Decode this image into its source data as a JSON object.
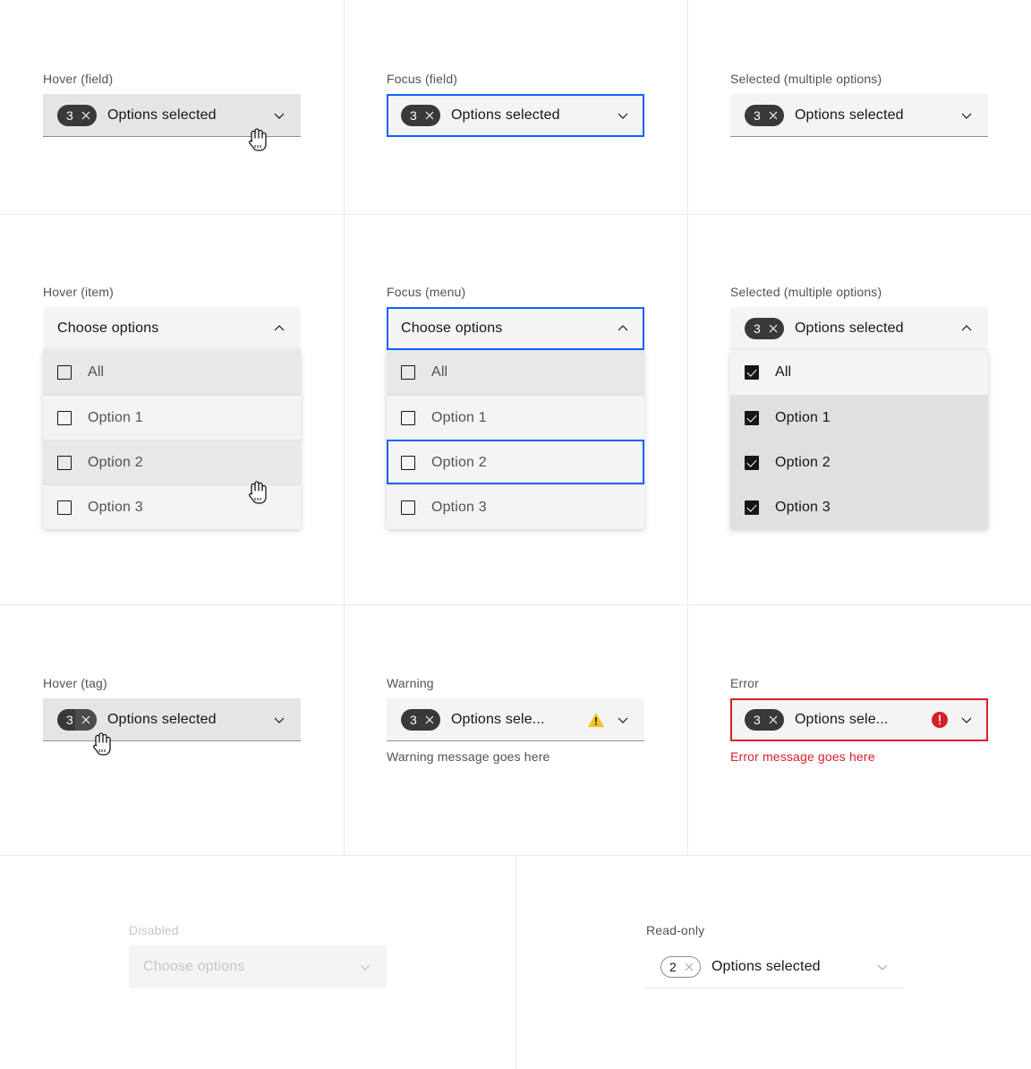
{
  "meta": {
    "component": "Multiselect dropdown states",
    "colors": {
      "field_bg": "#f4f4f4",
      "field_bg_hover": "#e5e5e5",
      "focus_blue": "#0f62fe",
      "error_red": "#da1e28",
      "warning_yellow": "#f1c21b",
      "tag_dark": "#393939",
      "text_primary": "#161616",
      "text_secondary": "#525252",
      "text_disabled": "#c6c6c6",
      "divider": "#e8e8e8",
      "menu_hover": "#e8e8e8",
      "menu_selected": "#e0e0e0"
    }
  },
  "cells": {
    "hover_field": {
      "caption": "Hover (field)",
      "tag_count": "3",
      "value": "Options selected",
      "chevron": "chevron-down-icon",
      "close": "close-icon"
    },
    "focus_field": {
      "caption": "Focus (field)",
      "tag_count": "3",
      "value": "Options selected",
      "chevron": "chevron-down-icon",
      "close": "close-icon"
    },
    "selected_field": {
      "caption": "Selected (multiple options)",
      "tag_count": "3",
      "value": "Options selected",
      "chevron": "chevron-down-icon",
      "close": "close-icon"
    },
    "hover_item": {
      "caption": "Hover (item)",
      "value": "Choose options",
      "chevron": "chevron-up-icon",
      "options": [
        {
          "label": "All",
          "checked": false,
          "state": "hl"
        },
        {
          "label": "Option 1",
          "checked": false,
          "state": ""
        },
        {
          "label": "Option 2",
          "checked": false,
          "state": "hl"
        },
        {
          "label": "Option 3",
          "checked": false,
          "state": ""
        }
      ]
    },
    "focus_menu": {
      "caption": "Focus (menu)",
      "value": "Choose options",
      "chevron": "chevron-up-icon",
      "options": [
        {
          "label": "All",
          "checked": false,
          "state": "hl"
        },
        {
          "label": "Option 1",
          "checked": false,
          "state": ""
        },
        {
          "label": "Option 2",
          "checked": false,
          "state": "kbdfocus"
        },
        {
          "label": "Option 3",
          "checked": false,
          "state": ""
        }
      ]
    },
    "selected_menu": {
      "caption": "Selected (multiple options)",
      "tag_count": "3",
      "value": "Options selected",
      "chevron": "chevron-up-icon",
      "close": "close-icon",
      "options": [
        {
          "label": "All",
          "checked": true,
          "state": "sel-all"
        },
        {
          "label": "Option 1",
          "checked": true,
          "state": "sel"
        },
        {
          "label": "Option 2",
          "checked": true,
          "state": "sel"
        },
        {
          "label": "Option 3",
          "checked": true,
          "state": "sel"
        }
      ]
    },
    "hover_tag": {
      "caption": "Hover (tag)",
      "tag_count": "3",
      "value": "Options selected",
      "chevron": "chevron-down-icon",
      "close": "close-icon"
    },
    "warning": {
      "caption": "Warning",
      "tag_count": "3",
      "value": "Options sele...",
      "chevron": "chevron-down-icon",
      "close": "close-icon",
      "status_icon": "warning-triangle-icon",
      "message": "Warning message goes here"
    },
    "error": {
      "caption": "Error",
      "tag_count": "3",
      "value": "Options sele...",
      "chevron": "chevron-down-icon",
      "close": "close-icon",
      "status_icon": "error-filled-icon",
      "message": "Error message goes here"
    },
    "disabled": {
      "caption": "Disabled",
      "value": "Choose options",
      "chevron": "chevron-down-icon"
    },
    "readonly": {
      "caption": "Read-only",
      "tag_count": "2",
      "value": "Options selected",
      "chevron": "chevron-down-icon",
      "close": "close-icon"
    }
  }
}
